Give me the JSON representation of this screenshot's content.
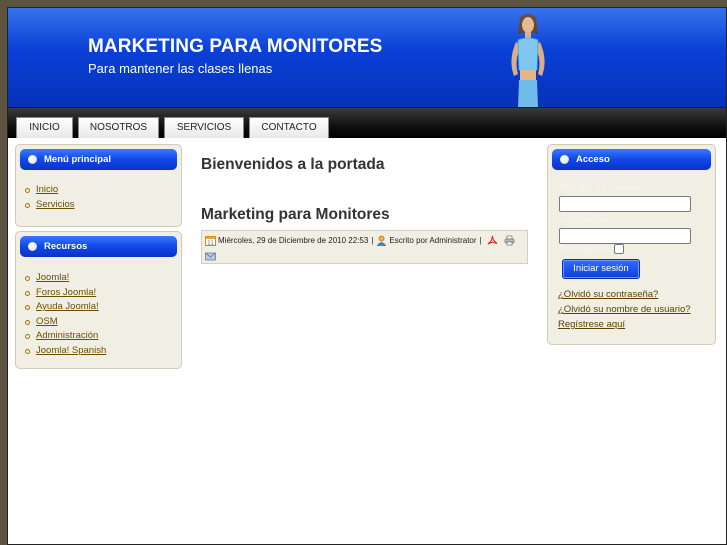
{
  "header": {
    "title": "MARKETING PARA MONITORES",
    "slogan": "Para mantener las clases llenas"
  },
  "nav": {
    "items": [
      "INICIO",
      "NOSOTROS",
      "SERVICIOS",
      "CONTACTO"
    ]
  },
  "left": {
    "main_menu": {
      "title": "Menú principal",
      "items": [
        "Inicio",
        "Servicios"
      ]
    },
    "resources": {
      "title": "Recursos",
      "items": [
        "Joomla!",
        "Foros Joomla!",
        "Ayuda Joomla!",
        "OSM",
        "Administración",
        "Joomla! Spanish"
      ]
    }
  },
  "content": {
    "welcome": "Bienvenidos a la portada",
    "article_title": "Marketing para Monitores",
    "date": "Miércoles, 29 de Diciembre de 2010 22:53",
    "separator": "|",
    "author": "Escrito por Administrator"
  },
  "login": {
    "title": "Acceso",
    "username_label": "Nombre de usuario",
    "password_label": "Contraseña",
    "remember_label": "Recordarme",
    "button": "Iniciar sesión",
    "forgot_password": "¿Olvidó su contraseña?",
    "forgot_username": "¿Olvidó su nombre de usuario?",
    "register": "Regístrese aquí"
  },
  "colors": {
    "header_blue": "#0a3fd6",
    "module_bg": "#f1eee3",
    "link_color": "#6a5000"
  },
  "icons": [
    "calendar-icon",
    "user-icon",
    "pdf-icon",
    "print-icon",
    "email-icon",
    "bullet-icon"
  ]
}
